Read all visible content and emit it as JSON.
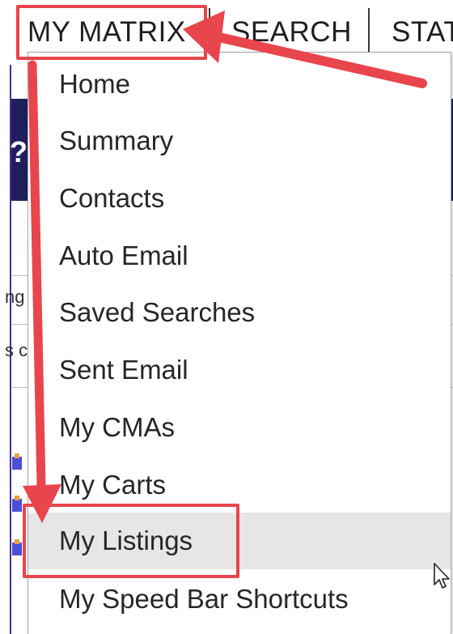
{
  "nav": {
    "tabs": [
      {
        "label": "MY MATRIX"
      },
      {
        "label": "SEARCH"
      },
      {
        "label": "STAT"
      }
    ]
  },
  "background": {
    "fragments": [
      "?",
      "ng",
      "s",
      "s c"
    ]
  },
  "menu": {
    "items": [
      {
        "label": "Home"
      },
      {
        "label": "Summary"
      },
      {
        "label": "Contacts"
      },
      {
        "label": "Auto Email"
      },
      {
        "label": "Saved Searches"
      },
      {
        "label": "Sent Email"
      },
      {
        "label": "My CMAs"
      },
      {
        "label": "My Carts"
      },
      {
        "label": "My Listings"
      },
      {
        "label": "My Speed Bar Shortcuts"
      }
    ],
    "highlighted_item": "My Listings"
  },
  "annotation": {
    "color": "#e8454d"
  },
  "colors": {
    "frame": "#4b2f8f",
    "band": "#1e1f5c",
    "hover": "#e6e6e6"
  }
}
